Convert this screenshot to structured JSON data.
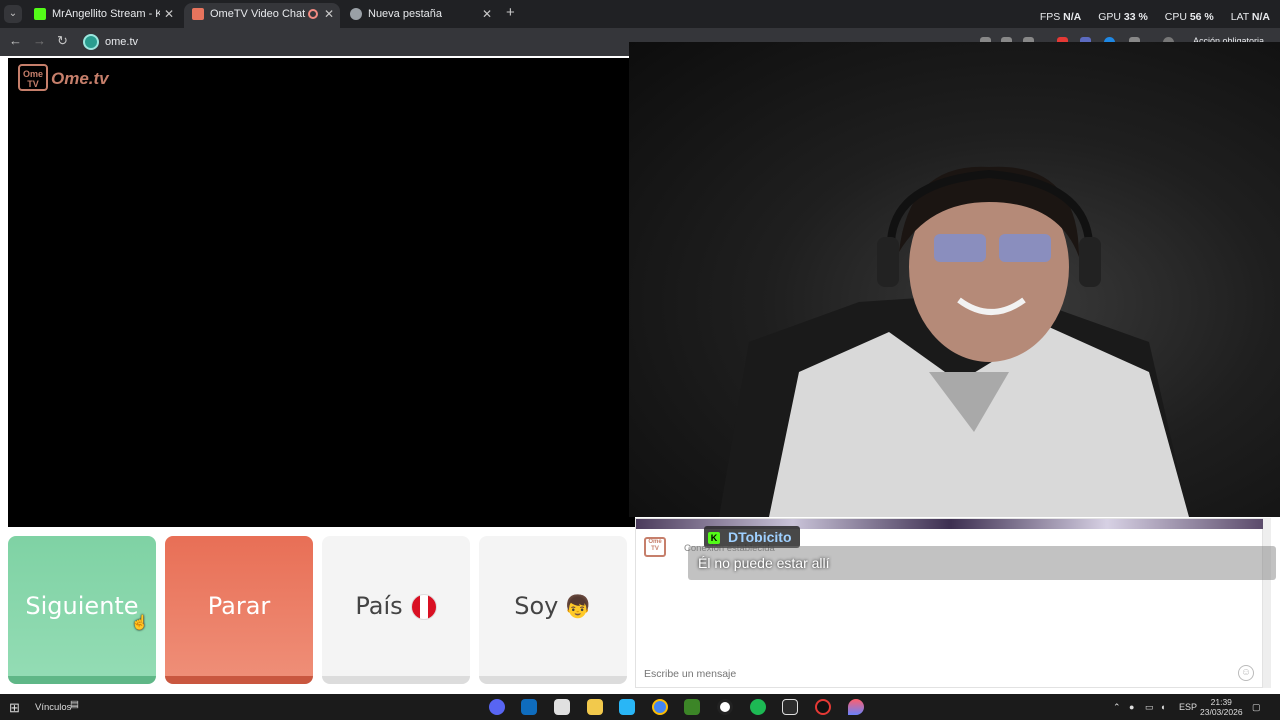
{
  "browser": {
    "tabs": [
      {
        "title": "MrAngellito Stream - Kick Dash",
        "active": false,
        "favicon_color": "#53fc18"
      },
      {
        "title": "OmeTV Video Chat — Ome",
        "active": true,
        "favicon_color": "#e8745d"
      },
      {
        "title": "Nueva pestaña",
        "active": false,
        "favicon_color": "#9aa0a6"
      }
    ],
    "new_tab": "+",
    "perf": {
      "fps_label": "FPS",
      "fps_value": "N/A",
      "gpu_label": "GPU",
      "gpu_value": "33 %",
      "cpu_label": "CPU",
      "cpu_value": "56 %",
      "lat_label": "LAT",
      "lat_value": "N/A"
    },
    "url": "ome.tv",
    "action_required": "Acción obligatoria"
  },
  "ome": {
    "logo_box": "Ome TV",
    "logo_text": "Ome.tv",
    "buttons": {
      "next": "Siguiente",
      "stop": "Parar",
      "country": "País",
      "gender": "Soy"
    },
    "gender_emoji": "👦",
    "chat": {
      "system_text": "Conexión establecida",
      "input_placeholder": "Escribe un mensaje",
      "overlay_user": "DTobicito",
      "overlay_message": "Él no puede estar allí"
    }
  },
  "taskbar": {
    "vinculos": "Vínculos",
    "language": "ESP",
    "time": "21:39",
    "date": "23/03/2026"
  },
  "colors": {
    "next": "#7fd2a4",
    "stop": "#e86f56",
    "brand": "#c67f6b"
  }
}
